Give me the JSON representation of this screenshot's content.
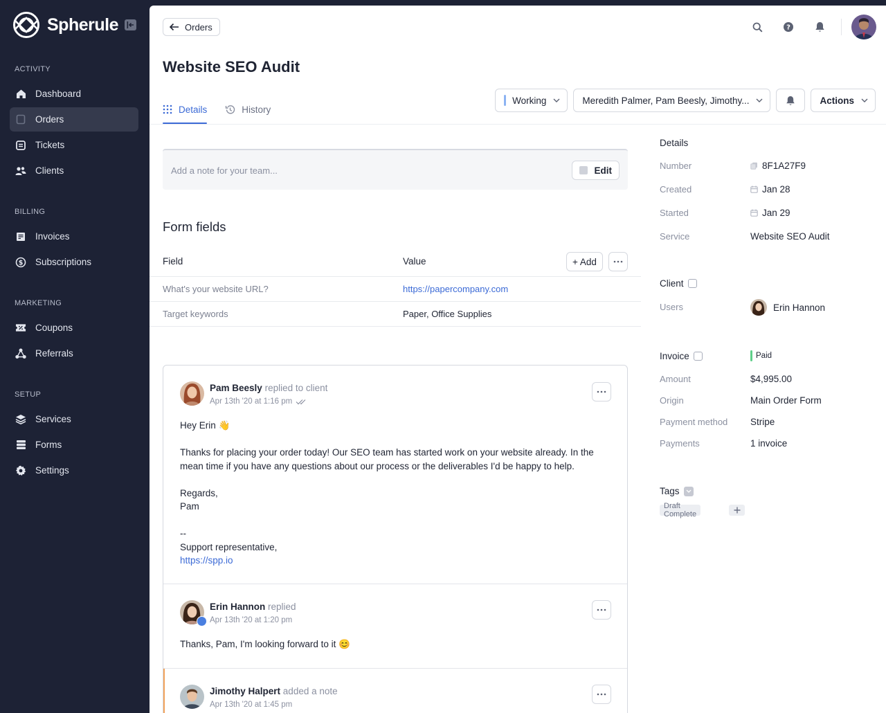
{
  "brand": {
    "name": "Spherule"
  },
  "sidebar": {
    "sections": [
      {
        "heading": "ACTIVITY",
        "items": [
          {
            "label": "Dashboard",
            "icon": "home-icon"
          },
          {
            "label": "Orders",
            "icon": "orders-icon",
            "active": true
          },
          {
            "label": "Tickets",
            "icon": "tickets-icon"
          },
          {
            "label": "Clients",
            "icon": "clients-icon"
          }
        ]
      },
      {
        "heading": "BILLING",
        "items": [
          {
            "label": "Invoices",
            "icon": "invoice-icon"
          },
          {
            "label": "Subscriptions",
            "icon": "subscriptions-icon"
          }
        ]
      },
      {
        "heading": "MARKETING",
        "items": [
          {
            "label": "Coupons",
            "icon": "coupon-icon"
          },
          {
            "label": "Referrals",
            "icon": "referrals-icon"
          }
        ]
      },
      {
        "heading": "SETUP",
        "items": [
          {
            "label": "Services",
            "icon": "services-icon"
          },
          {
            "label": "Forms",
            "icon": "forms-icon"
          },
          {
            "label": "Settings",
            "icon": "gear-icon"
          }
        ]
      }
    ]
  },
  "header": {
    "back_label": "Orders",
    "title": "Website SEO Audit",
    "tabs": [
      {
        "label": "Details"
      },
      {
        "label": "History"
      }
    ],
    "status": "Working",
    "assignees": "Meredith Palmer, Pam Beesly, Jimothy...",
    "actions_label": "Actions"
  },
  "note": {
    "placeholder": "Add a note for your team...",
    "edit_label": "Edit"
  },
  "form_fields": {
    "title": "Form fields",
    "col_field": "Field",
    "col_value": "Value",
    "add_label": "+ Add",
    "rows": [
      {
        "field": "What's your website URL?",
        "value": "https://papercompany.com"
      },
      {
        "field": "Target keywords",
        "value": "Paper, Office Supplies"
      }
    ]
  },
  "thread": [
    {
      "name": "Pam Beesly",
      "action": "replied to client",
      "time": "Apr 13th '20 at 1:16 pm",
      "lines": {
        "greeting": "Hey Erin 👋",
        "para1": "Thanks for placing your order today! Our SEO team has started work on your website already. In the mean time if you have any questions about our process or the deliverables I'd be happy to help.",
        "regards": "Regards,",
        "sign": "Pam",
        "dash": "--",
        "role": "Support representative,",
        "link": "https://spp.io"
      }
    },
    {
      "name": "Erin Hannon",
      "action": "replied",
      "time": "Apr 13th '20 at 1:20 pm",
      "text": "Thanks, Pam, I'm looking forward to it 😊"
    },
    {
      "name": "Jimothy Halpert",
      "action": "added a note",
      "time": "Apr 13th '20 at 1:45 pm"
    }
  ],
  "details": {
    "heading": "Details",
    "number_label": "Number",
    "number": "8F1A27F9",
    "created_label": "Created",
    "created": "Jan 28",
    "started_label": "Started",
    "started": "Jan 29",
    "service_label": "Service",
    "service": "Website SEO Audit",
    "client_heading": "Client",
    "users_label": "Users",
    "user": "Erin Hannon",
    "invoice_heading": "Invoice",
    "invoice_status": "Paid",
    "amount_label": "Amount",
    "amount": "$4,995.00",
    "origin_label": "Origin",
    "origin": "Main Order Form",
    "payment_method_label": "Payment method",
    "payment_method": "Stripe",
    "payments_label": "Payments",
    "payments": "1 invoice",
    "tags_heading": "Tags",
    "tags": [
      "Draft Complete"
    ]
  },
  "colors": {
    "accent": "#3b6ad6",
    "sidebar": "#1d2235",
    "paid": "#5fcf8a",
    "note_accent": "#f3a35b"
  }
}
